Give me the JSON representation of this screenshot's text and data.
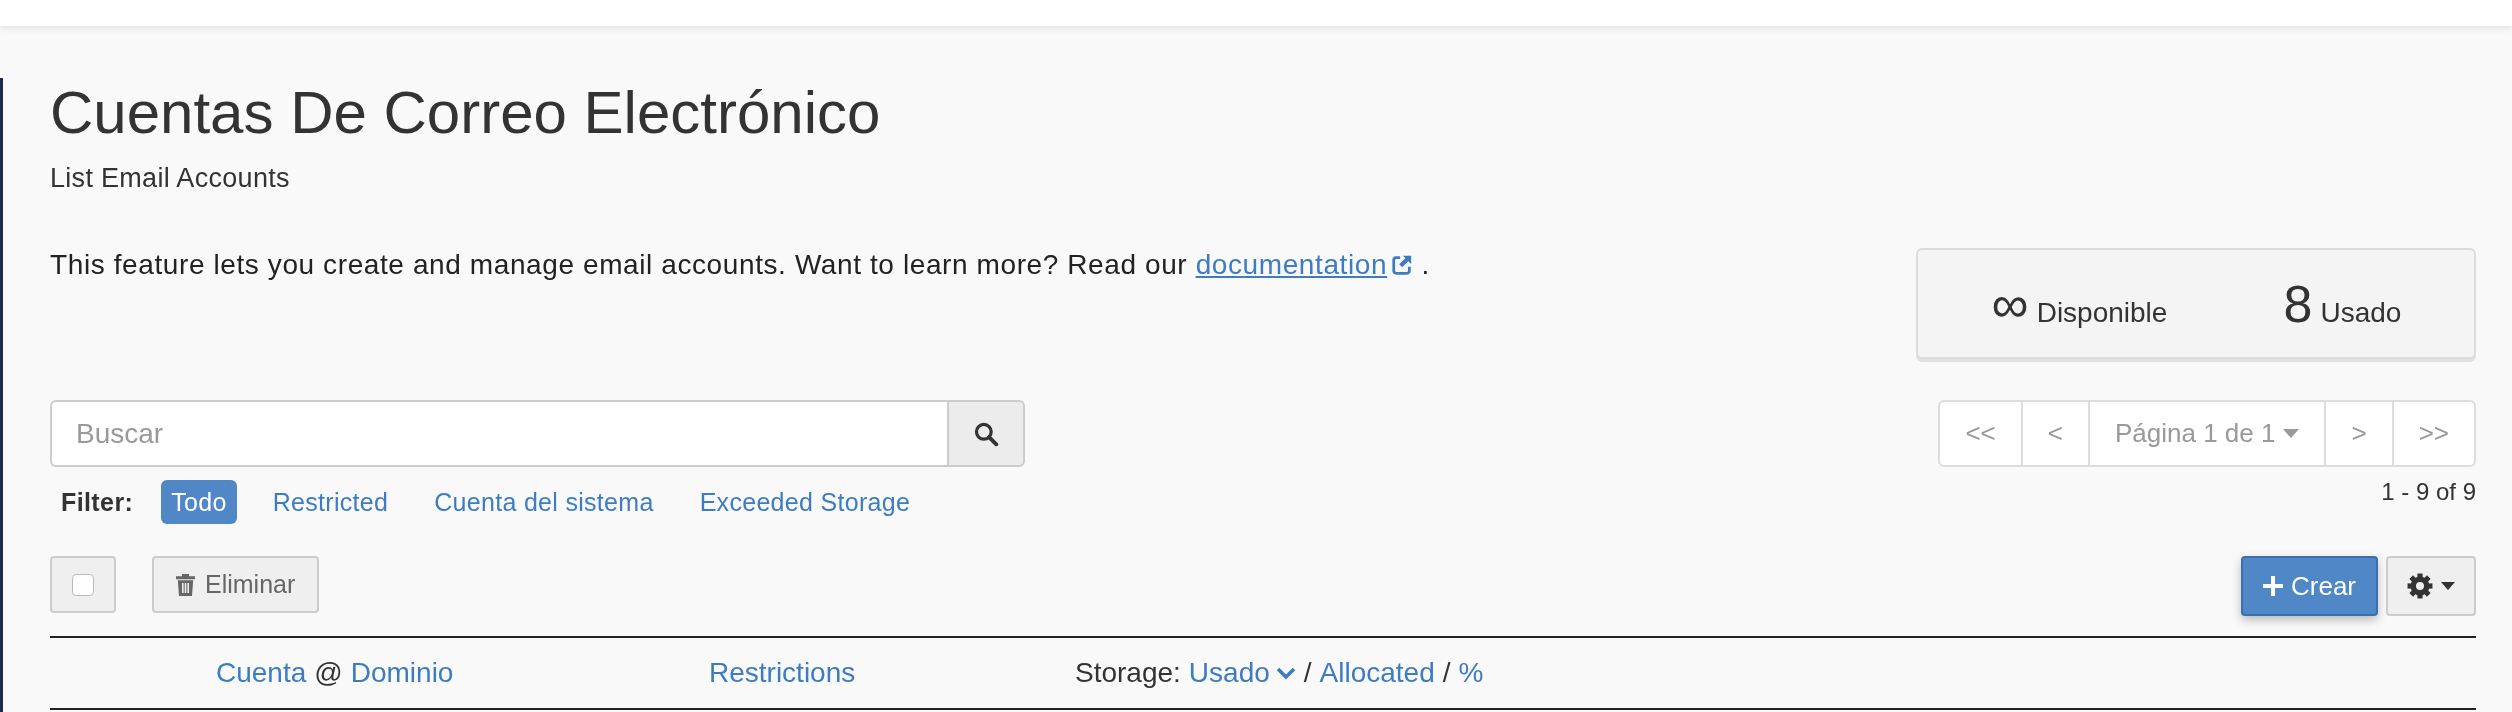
{
  "page": {
    "title": "Cuentas De Correo Electrónico",
    "subtitle": "List Email Accounts"
  },
  "description": {
    "text": "This feature lets you create and manage email accounts. Want to learn more? Read our",
    "link": "documentation",
    "end": "."
  },
  "stats": [
    {
      "value": "∞",
      "label": "Disponible"
    },
    {
      "value": "8",
      "label": "Usado"
    }
  ],
  "search": {
    "placeholder": "Buscar"
  },
  "filter": {
    "label": "Filter:",
    "options": [
      {
        "label": "Todo",
        "selected": true
      },
      {
        "label": "Restricted",
        "selected": false
      },
      {
        "label": "Cuenta del sistema",
        "selected": false
      },
      {
        "label": "Exceeded Storage",
        "selected": false
      }
    ]
  },
  "pagination": {
    "items": [
      {
        "kind": "button",
        "label": "<<"
      },
      {
        "kind": "button",
        "label": "<"
      },
      {
        "kind": "select",
        "label": "Página 1 de 1"
      },
      {
        "kind": "button",
        "label": ">"
      },
      {
        "kind": "button",
        "label": ">>"
      }
    ],
    "range": "1 - 9 of 9"
  },
  "toolbar": {
    "select_all": {
      "checked": false
    },
    "delete": "Eliminar",
    "create": "Crear"
  },
  "table": {
    "columns": [
      {
        "parts": [
          {
            "kind": "link",
            "text": "Cuenta",
            "sorted": false
          },
          {
            "kind": "text",
            "text": "@"
          },
          {
            "kind": "link",
            "text": "Dominio",
            "sorted": false
          }
        ]
      },
      {
        "parts": [
          {
            "kind": "link",
            "text": "Restrictions",
            "sorted": false
          }
        ]
      },
      {
        "parts": [
          {
            "kind": "text",
            "text": "Storage:"
          },
          {
            "kind": "link",
            "text": "Usado",
            "sorted": true
          },
          {
            "kind": "text",
            "text": "/"
          },
          {
            "kind": "link",
            "text": "Allocated",
            "sorted": false
          },
          {
            "kind": "text",
            "text": "/"
          },
          {
            "kind": "link",
            "text": "%",
            "sorted": false
          }
        ]
      }
    ]
  }
}
